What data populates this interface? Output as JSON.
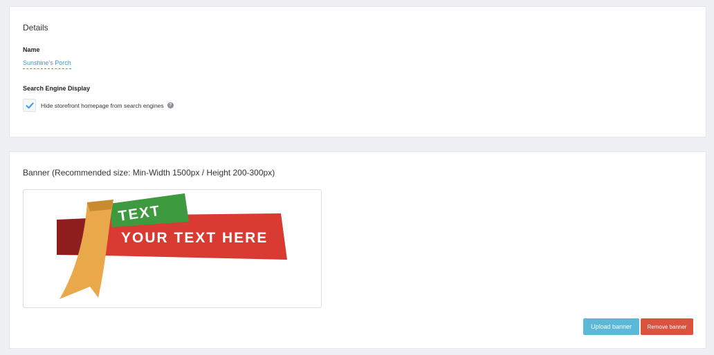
{
  "details": {
    "title": "Details",
    "name_label": "Name",
    "name_value": "Sunshine's Porch",
    "seo_label": "Search Engine Display",
    "hide_checkbox": {
      "label": "Hide storefront homepage from search engines",
      "checked": true
    },
    "help_icon": "?"
  },
  "banner": {
    "title": "Banner (Recommended size: Min-Width 1500px / Height 200-300px)",
    "image": {
      "text_small": "TEXT",
      "text_large": "YOUR TEXT HERE"
    },
    "upload_label": "Upload banner",
    "remove_label": "Remove banner"
  },
  "colors": {
    "background": "#eef0f3",
    "link": "#3a9bbf",
    "checkmark": "#3a9bd6",
    "upload_button": "#5bb8d6",
    "remove_button": "#d9533e",
    "ribbon_red": "#d93a32",
    "ribbon_green": "#3e9a3f",
    "ribbon_gold": "#e9a84a"
  }
}
